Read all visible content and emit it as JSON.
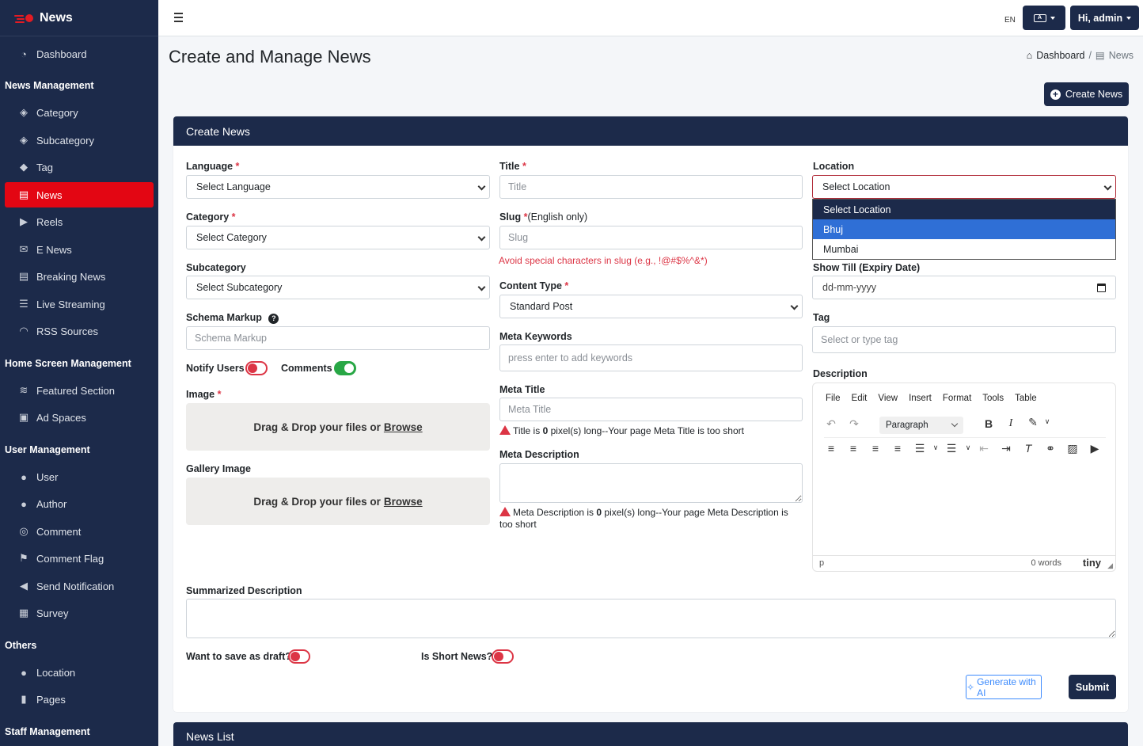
{
  "app": {
    "name": "News"
  },
  "sidebar": {
    "dashboard": "Dashboard",
    "sections": {
      "news_management": "News Management",
      "home_screen_management": "Home Screen Management",
      "user_management": "User Management",
      "others": "Others",
      "staff_management": "Staff Management"
    },
    "items": {
      "category": "Category",
      "subcategory": "Subcategory",
      "tag": "Tag",
      "news": "News",
      "reels": "Reels",
      "e_news": "E News",
      "breaking_news": "Breaking News",
      "live_streaming": "Live Streaming",
      "rss_sources": "RSS Sources",
      "featured_section": "Featured Section",
      "ad_spaces": "Ad Spaces",
      "user": "User",
      "author": "Author",
      "comment": "Comment",
      "comment_flag": "Comment Flag",
      "send_notification": "Send Notification",
      "survey": "Survey",
      "location": "Location",
      "pages": "Pages"
    },
    "active_item": "news",
    "accent_color": "#e30613"
  },
  "topbar": {
    "language_code": "EN",
    "user_greeting": "Hi, admin"
  },
  "page": {
    "title": "Create and Manage News",
    "breadcrumb": [
      "Dashboard",
      "News"
    ],
    "create_button": "Create News"
  },
  "form": {
    "header": "Create News",
    "language": {
      "label": "Language",
      "value": "Select Language"
    },
    "category": {
      "label": "Category",
      "value": "Select Category"
    },
    "subcategory": {
      "label": "Subcategory",
      "value": "Select Subcategory"
    },
    "schema_markup": {
      "label": "Schema Markup",
      "placeholder": "Schema Markup"
    },
    "notify_users": {
      "label": "Notify Users",
      "on": false
    },
    "comments": {
      "label": "Comments",
      "on": true
    },
    "image": {
      "label": "Image",
      "drop_text": "Drag & Drop your files or",
      "browse": "Browse"
    },
    "gallery_image": {
      "label": "Gallery Image",
      "drop_text": "Drag & Drop your files or",
      "browse": "Browse"
    },
    "title": {
      "label": "Title",
      "placeholder": "Title"
    },
    "slug": {
      "label": "Slug",
      "note": "(English only)",
      "placeholder": "Slug",
      "help": "Avoid special characters in slug (e.g., !@#$%^&*)"
    },
    "content_type": {
      "label": "Content Type",
      "value": "Standard Post"
    },
    "meta_keywords": {
      "label": "Meta Keywords",
      "placeholder": "press enter to add keywords"
    },
    "meta_title": {
      "label": "Meta Title",
      "placeholder": "Meta Title",
      "warn_prefix": "Title is",
      "warn_count": "0",
      "warn_suffix": "pixel(s) long--Your page Meta Title is too short"
    },
    "meta_description": {
      "label": "Meta Description",
      "warn_prefix": "Meta Description is",
      "warn_count": "0",
      "warn_suffix": "pixel(s) long--Your page Meta Description is too short"
    },
    "location": {
      "label": "Location",
      "value": "Select Location",
      "options": [
        "Select Location",
        "Bhuj",
        "Mumbai"
      ],
      "highlighted": "Bhuj"
    },
    "show_till": {
      "label": "Show Till (Expiry Date)",
      "placeholder": "dd-mm-yyyy"
    },
    "tag": {
      "label": "Tag",
      "placeholder": "Select or type tag"
    },
    "description": {
      "label": "Description",
      "menu": [
        "File",
        "Edit",
        "View",
        "Insert",
        "Format",
        "Tools",
        "Table"
      ],
      "block_format": "Paragraph",
      "status_path": "p",
      "word_count": "0 words",
      "brand": "tiny"
    },
    "summarized_description": {
      "label": "Summarized Description"
    },
    "save_draft": {
      "label": "Want to save as draft?",
      "on": false
    },
    "short_news": {
      "label": "Is Short News?",
      "on": false
    },
    "generate_ai": "Generate with AI",
    "submit": "Submit"
  },
  "news_list": {
    "header": "News List"
  },
  "colors": {
    "navy": "#1c2a4a",
    "danger": "#dc3545",
    "success": "#28a745",
    "primary": "#2f6fd6"
  }
}
